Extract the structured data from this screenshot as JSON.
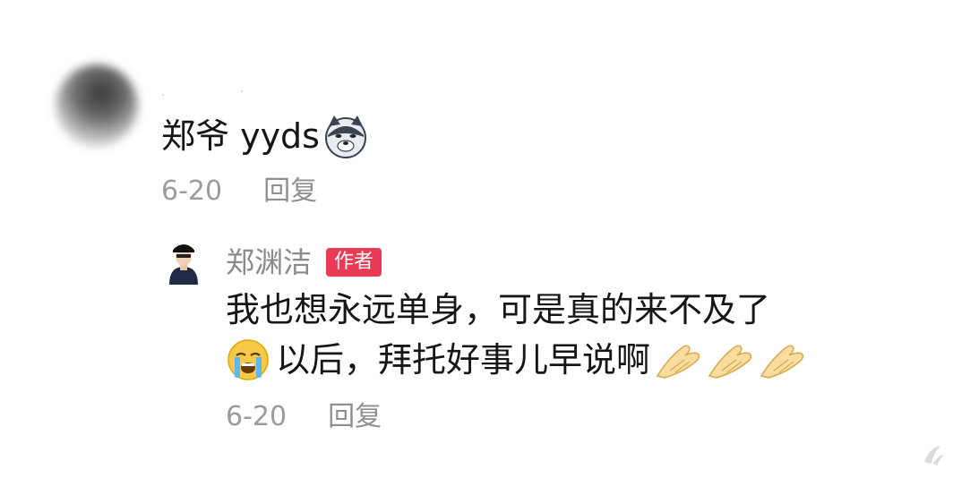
{
  "comment": {
    "text": "郑爷 yyds",
    "emoji_icon": "wolf-emoji-icon",
    "date": "6-20",
    "reply_label": "回复"
  },
  "reply": {
    "author_name": "郑渊洁",
    "author_badge": "作者",
    "line1": "我也想永远单身，可是真的来不及了",
    "line2": "以后，拜托好事儿早说啊",
    "cry_emoji_icon": "crying-emoji-icon",
    "hand_emoji_icon": "pray-hand-emoji-icon",
    "date": "6-20",
    "reply_label": "回复"
  },
  "colors": {
    "badge": "#ea3a55",
    "meta_text": "#9b9b9b",
    "main_text": "#161616"
  }
}
